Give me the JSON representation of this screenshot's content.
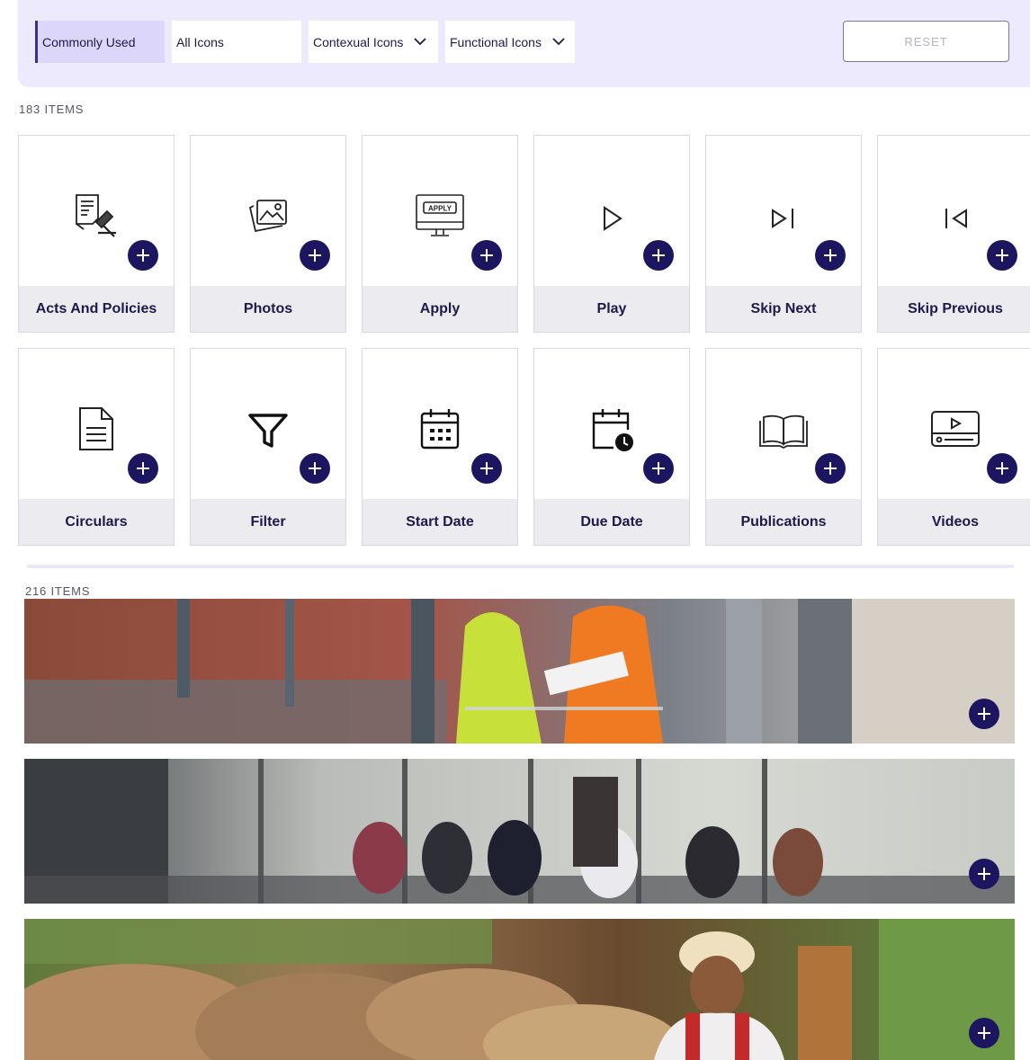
{
  "filters": {
    "tabs": [
      {
        "label": "Commonly Used",
        "active": true
      },
      {
        "label": "All Icons",
        "active": false
      },
      {
        "label": "Contexual Icons",
        "active": false,
        "dropdown": true
      },
      {
        "label": "Functional Icons",
        "active": false,
        "dropdown": true
      }
    ],
    "reset_label": "RESET"
  },
  "icons_section": {
    "count_label": "183 ITEMS",
    "items": [
      {
        "label": "Acts And Policies",
        "icon": "acts-and-policies-icon"
      },
      {
        "label": "Photos",
        "icon": "photos-icon"
      },
      {
        "label": "Apply",
        "icon": "apply-monitor-icon",
        "icon_text": "APPLY"
      },
      {
        "label": "Play",
        "icon": "play-icon"
      },
      {
        "label": "Skip Next",
        "icon": "skip-next-icon"
      },
      {
        "label": "Skip Previous",
        "icon": "skip-previous-icon"
      },
      {
        "label": "Circulars",
        "icon": "document-icon"
      },
      {
        "label": "Filter",
        "icon": "filter-icon"
      },
      {
        "label": "Start Date",
        "icon": "calendar-icon"
      },
      {
        "label": "Due Date",
        "icon": "calendar-clock-icon"
      },
      {
        "label": "Publications",
        "icon": "open-book-icon"
      },
      {
        "label": "Videos",
        "icon": "video-player-icon"
      }
    ]
  },
  "images_section": {
    "count_label": "216 ITEMS",
    "items": [
      {
        "name": "construction-workers-image"
      },
      {
        "name": "meeting-room-image"
      },
      {
        "name": "farmer-with-grain-sacks-image"
      }
    ]
  },
  "colors": {
    "accent": "#1c1660",
    "filter_bg": "#eeeafe",
    "active_tab_bg": "#ddd6fb",
    "caption_bg": "#ebebf0",
    "text": "#1c1a4a"
  }
}
